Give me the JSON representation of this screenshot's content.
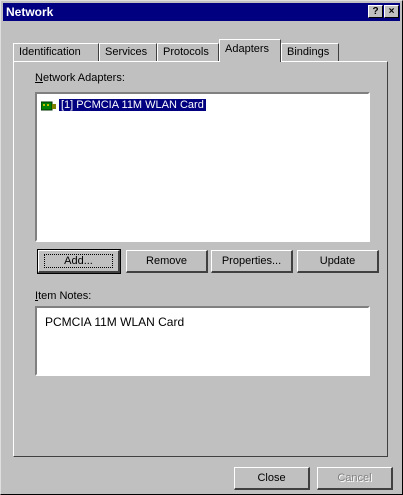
{
  "window": {
    "title": "Network",
    "help_glyph": "?",
    "close_glyph": "×"
  },
  "tabs": [
    "Identification",
    "Services",
    "Protocols",
    "Adapters",
    "Bindings"
  ],
  "adapters": {
    "label": "Network Adapters:",
    "items": [
      {
        "text": "[1] PCMCIA 11M WLAN Card",
        "icon": "network-card-icon",
        "selected": true
      }
    ]
  },
  "buttons": {
    "add": "Add...",
    "remove": "Remove",
    "properties": "Properties...",
    "update": "Update"
  },
  "notes": {
    "label": "Item Notes:",
    "text": "PCMCIA 11M WLAN Card"
  },
  "footer": {
    "close": "Close",
    "cancel": "Cancel"
  },
  "colors": {
    "title_bar": "#000080",
    "selection": "#000080",
    "face": "#c0c0c0"
  }
}
